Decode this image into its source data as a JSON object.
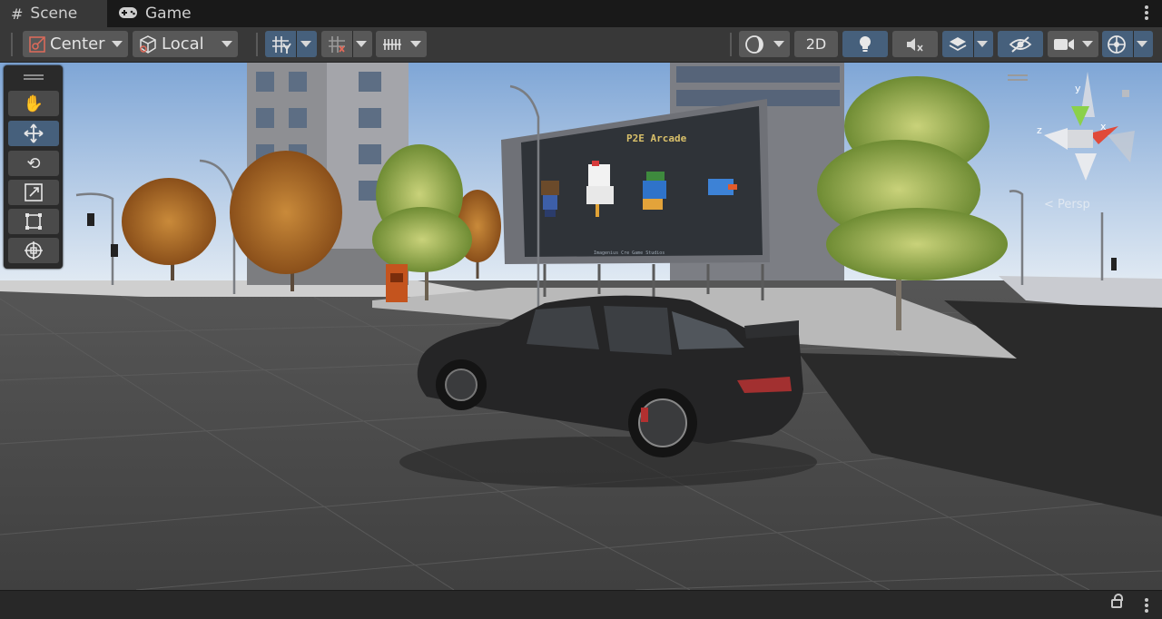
{
  "tabs": [
    {
      "label": "Scene",
      "icon": "hash-icon",
      "active": true
    },
    {
      "label": "Game",
      "icon": "gamepad-icon",
      "active": false
    }
  ],
  "toolbar": {
    "pivot_label": "Center",
    "space_label": "Local",
    "mode_2d_label": "2D"
  },
  "gizmo": {
    "y_label": "y",
    "x_label": "x",
    "z_label": "z",
    "persp_label": "< Persp"
  },
  "billboard": {
    "title": "P2E Arcade",
    "subtitle": "Imagenius Cre Game Studios"
  },
  "colors": {
    "tab_active": "#383838",
    "toolbar": "#383838",
    "button": "#585858",
    "button_active": "#46607c",
    "sky_top": "#8fb2dc",
    "ground": "#4a4a4a"
  }
}
